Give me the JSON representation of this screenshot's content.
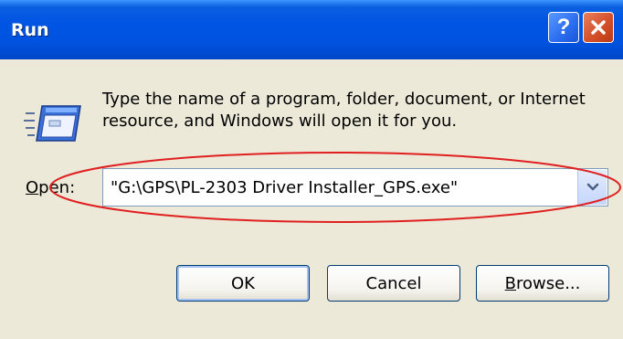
{
  "window": {
    "title": "Run",
    "help_button": "?",
    "close_button": "close"
  },
  "description": "Type the name of a program, folder, document, or Internet resource, and Windows will open it for you.",
  "open_field": {
    "label_mnemonic": "O",
    "label_rest": "pen:",
    "value": "\"G:\\GPS\\PL-2303 Driver Installer_GPS.exe\""
  },
  "buttons": {
    "ok": "OK",
    "cancel": "Cancel",
    "browse_mnemonic": "B",
    "browse_rest": "rowse..."
  },
  "annotation": {
    "ellipse_color": "#e02020"
  },
  "colors": {
    "titlebar": "#0054e3",
    "dialog_bg": "#ece9d8",
    "close_button": "#d4502a"
  }
}
